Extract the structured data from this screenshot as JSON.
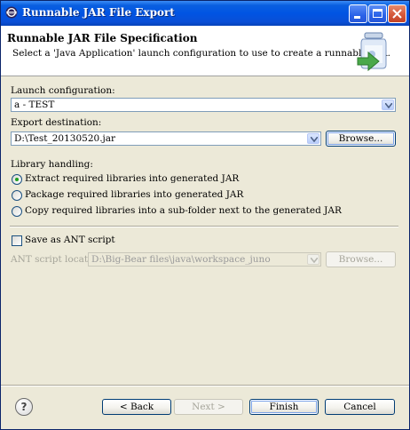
{
  "window": {
    "title": "Runnable JAR File Export"
  },
  "header": {
    "title": "Runnable JAR File Specification",
    "description": "Select a 'Java Application' launch configuration to use to create a runnable JAR."
  },
  "launch": {
    "label": "Launch configuration:",
    "value": "a - TEST"
  },
  "export": {
    "label": "Export destination:",
    "value": "D:\\Test_20130520.jar",
    "browse_label": "Browse..."
  },
  "library": {
    "label": "Library handling:",
    "options": [
      {
        "label": "Extract required libraries into generated JAR",
        "selected": true
      },
      {
        "label": "Package required libraries into generated JAR",
        "selected": false
      },
      {
        "label": "Copy required libraries into a sub-folder next to the generated JAR",
        "selected": false
      }
    ]
  },
  "ant": {
    "save_label": "Save as ANT script",
    "checked": false,
    "location_label": "ANT script location:",
    "location_value": "D:\\Big-Bear files\\java\\workspace_juno",
    "browse_label": "Browse..."
  },
  "footer": {
    "back_label": "< Back",
    "next_label": "Next >",
    "finish_label": "Finish",
    "cancel_label": "Cancel"
  },
  "colors": {
    "title_bar": "#0054e3",
    "dialog_bg": "#ece9d8",
    "radio_dot": "#21a121"
  }
}
